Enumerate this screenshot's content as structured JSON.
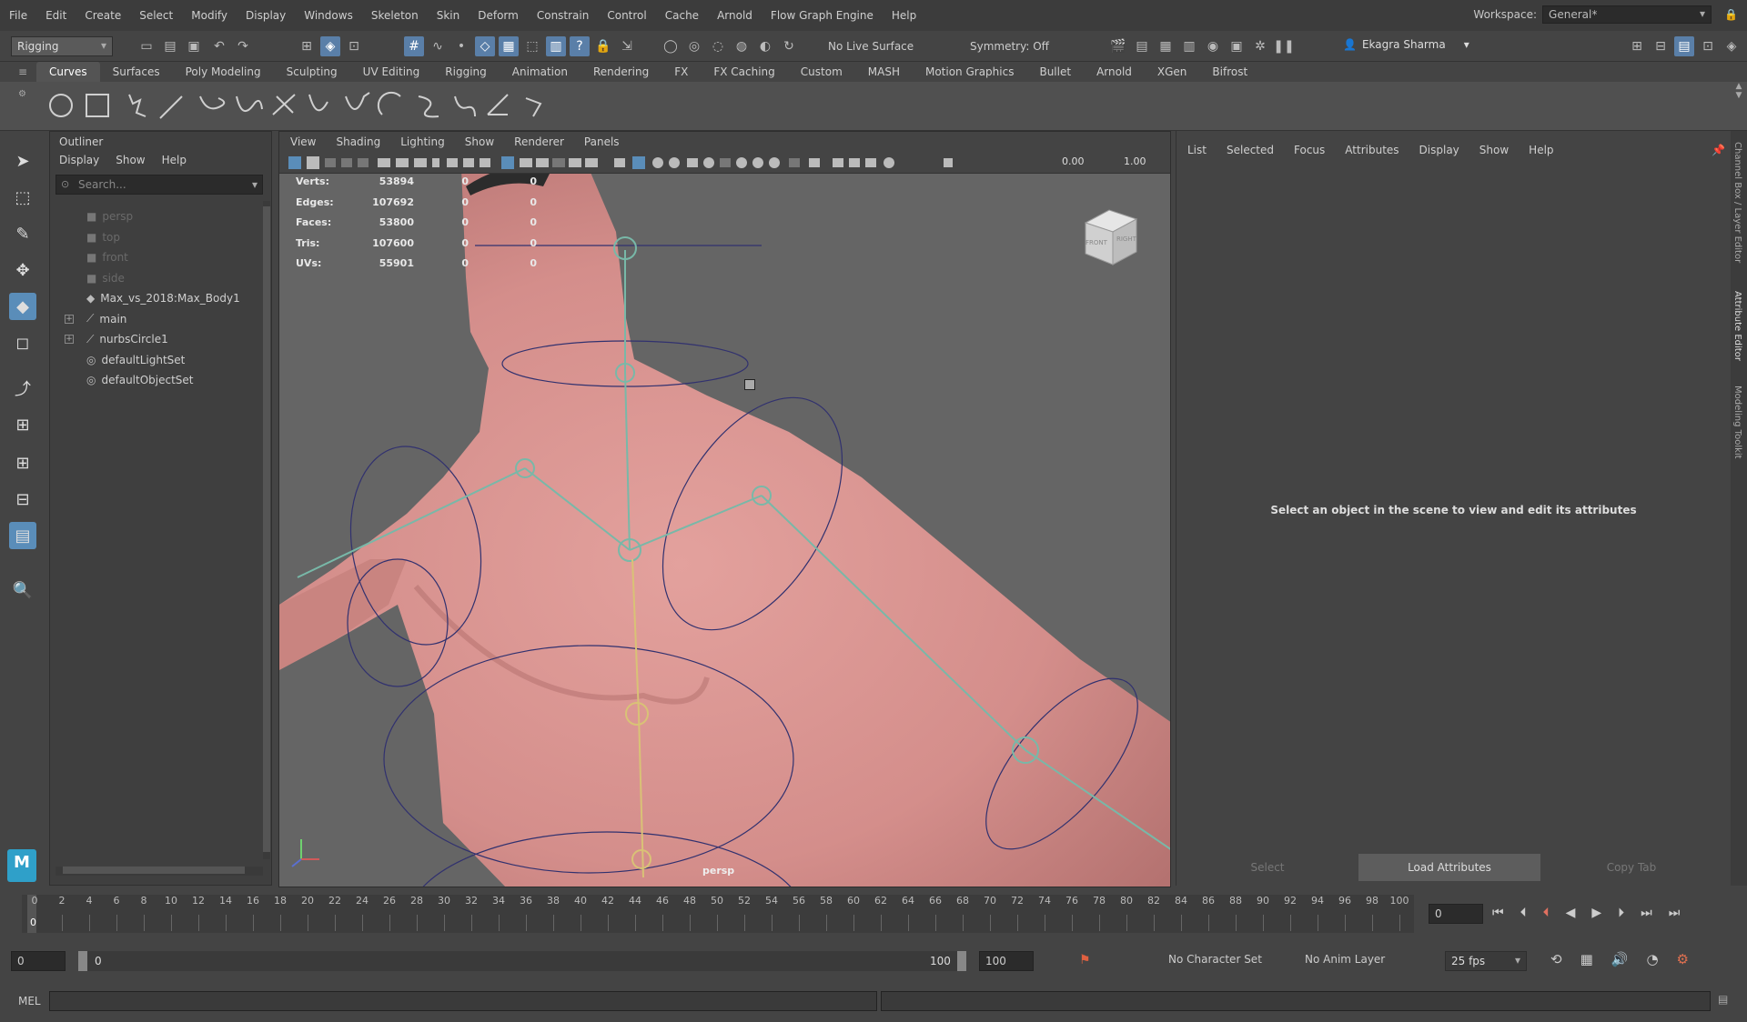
{
  "menubar": [
    "File",
    "Edit",
    "Create",
    "Select",
    "Modify",
    "Display",
    "Windows",
    "Skeleton",
    "Skin",
    "Deform",
    "Constrain",
    "Control",
    "Cache",
    "Arnold",
    "Flow Graph Engine",
    "Help"
  ],
  "workspace": {
    "label": "Workspace:",
    "value": "General*"
  },
  "status": {
    "menuset": "Rigging",
    "live_surface": "No Live Surface",
    "symmetry": "Symmetry: Off",
    "user": "Ekagra Sharma"
  },
  "shelf_tabs": [
    "Curves",
    "Surfaces",
    "Poly Modeling",
    "Sculpting",
    "UV Editing",
    "Rigging",
    "Animation",
    "Rendering",
    "FX",
    "FX Caching",
    "Custom",
    "MASH",
    "Motion Graphics",
    "Bullet",
    "Arnold",
    "XGen",
    "Bifrost"
  ],
  "shelf_active": "Curves",
  "outliner": {
    "title": "Outliner",
    "menus": [
      "Display",
      "Show",
      "Help"
    ],
    "search_placeholder": "Search...",
    "items": [
      {
        "label": "persp",
        "dim": true,
        "icon": "camera-icon"
      },
      {
        "label": "top",
        "dim": true,
        "icon": "camera-icon"
      },
      {
        "label": "front",
        "dim": true,
        "icon": "camera-icon"
      },
      {
        "label": "side",
        "dim": true,
        "icon": "camera-icon"
      },
      {
        "label": "Max_vs_2018:Max_Body1",
        "dim": false,
        "icon": "mesh-icon"
      },
      {
        "label": "main",
        "dim": false,
        "icon": "curve-icon",
        "expand": true
      },
      {
        "label": "nurbsCircle1",
        "dim": false,
        "icon": "curve-icon",
        "expand": true
      },
      {
        "label": "defaultLightSet",
        "dim": false,
        "icon": "set-icon"
      },
      {
        "label": "defaultObjectSet",
        "dim": false,
        "icon": "set-icon"
      }
    ]
  },
  "viewport": {
    "menus": [
      "View",
      "Shading",
      "Lighting",
      "Show",
      "Renderer",
      "Panels"
    ],
    "exposure": "0.00",
    "gamma": "1.00",
    "camera": "persp",
    "viewcube": {
      "front": "FRONT",
      "right": "RIGHT"
    },
    "hud": [
      {
        "label": "Verts:",
        "v": "53894",
        "a": "0",
        "b": "0"
      },
      {
        "label": "Edges:",
        "v": "107692",
        "a": "0",
        "b": "0"
      },
      {
        "label": "Faces:",
        "v": "53800",
        "a": "0",
        "b": "0"
      },
      {
        "label": "Tris:",
        "v": "107600",
        "a": "0",
        "b": "0"
      },
      {
        "label": "UVs:",
        "v": "55901",
        "a": "0",
        "b": "0"
      }
    ]
  },
  "attribute_editor": {
    "menus": [
      "List",
      "Selected",
      "Focus",
      "Attributes",
      "Display",
      "Show",
      "Help"
    ],
    "message": "Select an object in the scene to view and edit its attributes",
    "buttons": {
      "select": "Select",
      "load": "Load Attributes",
      "copy": "Copy Tab"
    }
  },
  "side_tabs": [
    "Channel Box / Layer Editor",
    "Attribute Editor",
    "Modeling Toolkit"
  ],
  "timeline": {
    "ticks": [
      "0",
      "2",
      "4",
      "6",
      "8",
      "10",
      "12",
      "14",
      "16",
      "18",
      "20",
      "22",
      "24",
      "26",
      "28",
      "30",
      "32",
      "34",
      "36",
      "38",
      "40",
      "42",
      "44",
      "46",
      "48",
      "50",
      "52",
      "54",
      "56",
      "58",
      "60",
      "62",
      "64",
      "66",
      "68",
      "70",
      "72",
      "74",
      "76",
      "78",
      "80",
      "82",
      "84",
      "86",
      "88",
      "90",
      "92",
      "94",
      "96",
      "98",
      "100"
    ],
    "current": "0",
    "current_field": "0"
  },
  "range": {
    "start": "0",
    "inner_start": "0",
    "inner_end": "100",
    "end": "100",
    "char_set": "No Character Set",
    "anim_layer": "No Anim Layer",
    "fps": "25 fps"
  },
  "cmd": {
    "label": "MEL"
  },
  "colors": {
    "accent": "#5a8db9",
    "skin": "#d79390",
    "viewport_bg": "#656565"
  }
}
